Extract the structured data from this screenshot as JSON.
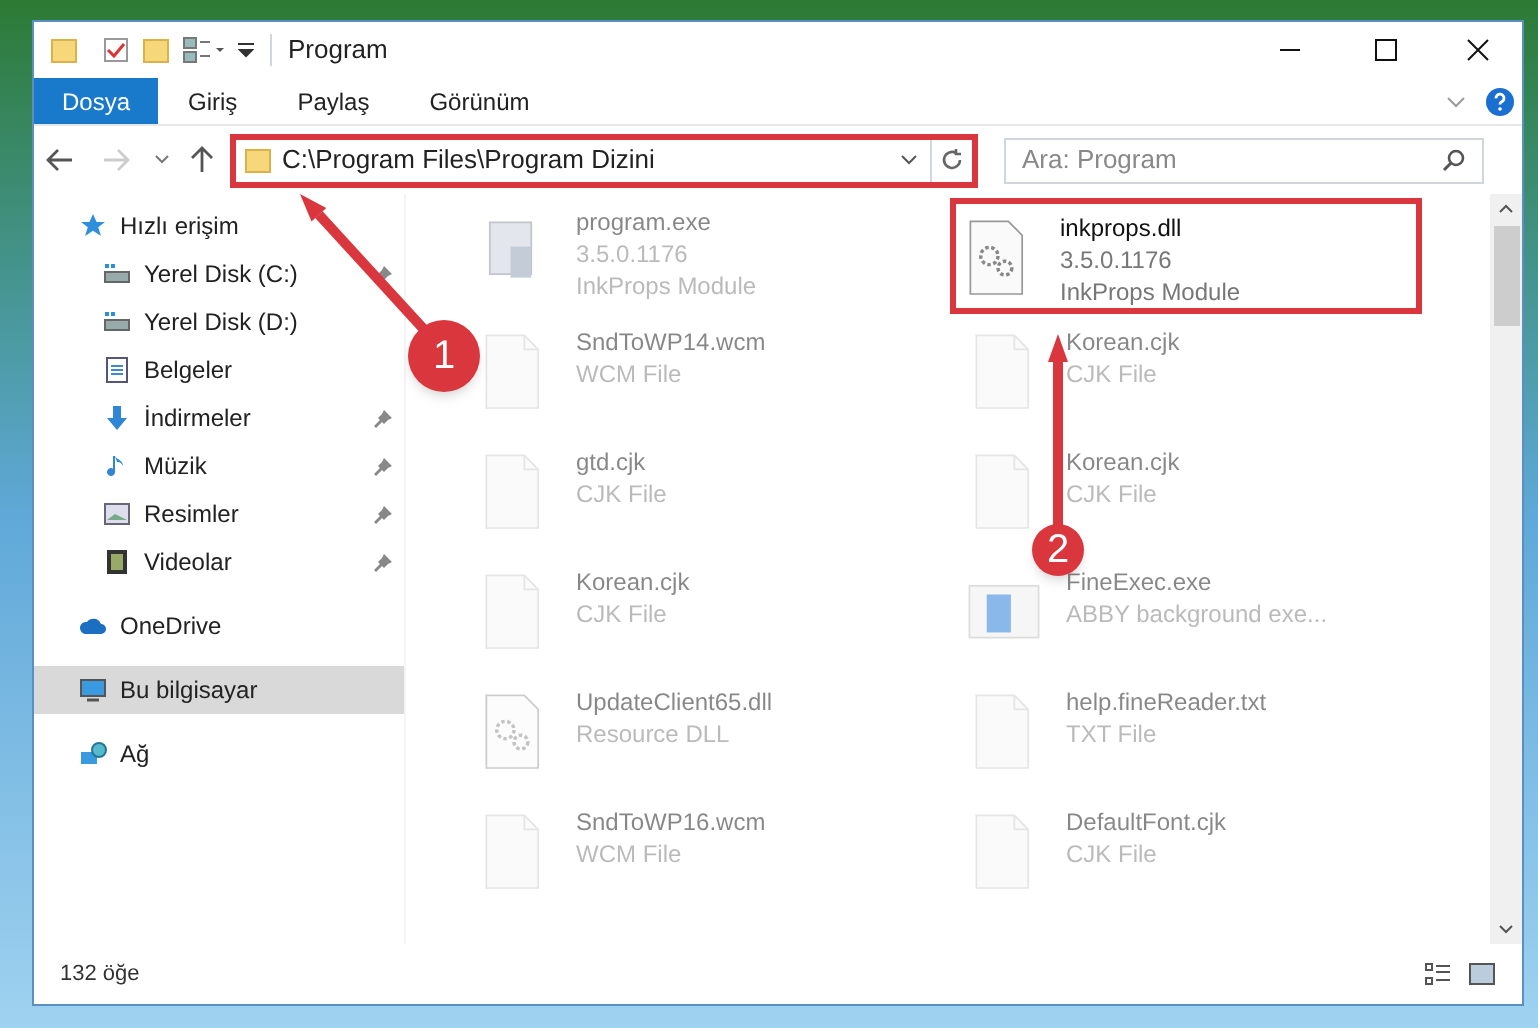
{
  "window": {
    "title": "Program"
  },
  "ribbon_tabs": [
    {
      "label": "Dosya",
      "selected": true
    },
    {
      "label": "Giriş",
      "selected": false
    },
    {
      "label": "Paylaş",
      "selected": false
    },
    {
      "label": "Görünüm",
      "selected": false
    }
  ],
  "address_bar": {
    "path": "C:\\Program Files\\Program Dizini",
    "highlighted": true
  },
  "search": {
    "placeholder": "Ara: Program"
  },
  "sidebar": {
    "items": [
      {
        "label": "Hızlı erişim",
        "kind": "star",
        "selected": false,
        "children": [
          {
            "label": "Yerel Disk (C:)",
            "kind": "drive",
            "pinned": true,
            "selected": false
          },
          {
            "label": "Yerel Disk (D:)",
            "kind": "drive",
            "pinned": false,
            "selected": false
          },
          {
            "label": "Belgeler",
            "kind": "docs",
            "pinned": false,
            "selected": false
          },
          {
            "label": "İndirmeler",
            "kind": "download",
            "pinned": true,
            "selected": false
          },
          {
            "label": "Müzik",
            "kind": "music",
            "pinned": true,
            "selected": false
          },
          {
            "label": "Resimler",
            "kind": "pictures",
            "pinned": true,
            "selected": false
          },
          {
            "label": "Videolar",
            "kind": "video",
            "pinned": true,
            "selected": false
          }
        ]
      },
      {
        "label": "OneDrive",
        "kind": "cloud",
        "selected": false
      },
      {
        "label": "Bu bilgisayar",
        "kind": "pc",
        "selected": true
      },
      {
        "label": "Ağ",
        "kind": "network",
        "selected": false
      }
    ]
  },
  "files": [
    {
      "name": "program.exe",
      "details": [
        "3.5.0.1176",
        "InkProps Module"
      ],
      "kind": "exe",
      "blurred": true,
      "highlighted": false
    },
    {
      "name": "inkprops.dll",
      "details": [
        "3.5.0.1176",
        "InkProps Module"
      ],
      "kind": "dll",
      "blurred": false,
      "highlighted": true
    },
    {
      "name": "SndToWP14.wcm",
      "details": [
        "WCM File"
      ],
      "kind": "blank",
      "blurred": true,
      "highlighted": false
    },
    {
      "name": "Korean.cjk",
      "details": [
        "CJK File"
      ],
      "kind": "blank",
      "blurred": true,
      "highlighted": false
    },
    {
      "name": "gtd.cjk",
      "details": [
        "CJK File"
      ],
      "kind": "blank",
      "blurred": true,
      "highlighted": false
    },
    {
      "name": "Korean.cjk",
      "details": [
        "CJK File"
      ],
      "kind": "blank",
      "blurred": true,
      "highlighted": false
    },
    {
      "name": "Korean.cjk",
      "details": [
        "CJK File"
      ],
      "kind": "blank",
      "blurred": true,
      "highlighted": false
    },
    {
      "name": "FineExec.exe",
      "details": [
        "ABBY background exe..."
      ],
      "kind": "app",
      "blurred": true,
      "highlighted": false
    },
    {
      "name": "UpdateClient65.dll",
      "details": [
        "Resource DLL"
      ],
      "kind": "dll",
      "blurred": true,
      "highlighted": false
    },
    {
      "name": "help.fineReader.txt",
      "details": [
        "TXT File"
      ],
      "kind": "blank",
      "blurred": true,
      "highlighted": false
    },
    {
      "name": "SndToWP16.wcm",
      "details": [
        "WCM File"
      ],
      "kind": "blank",
      "blurred": true,
      "highlighted": false
    },
    {
      "name": "DefaultFont.cjk",
      "details": [
        "CJK File"
      ],
      "kind": "blank",
      "blurred": true,
      "highlighted": false
    }
  ],
  "status_bar": {
    "count": "132 öğe"
  },
  "annotations": [
    {
      "number": "1"
    },
    {
      "number": "2"
    }
  ]
}
